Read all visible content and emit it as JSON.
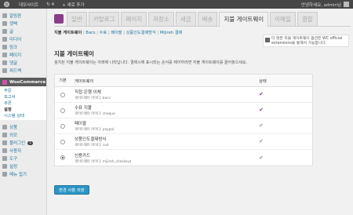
{
  "adminbar": {
    "site_name": "데모사이트",
    "updates_count": "4",
    "new_item": "+ 새로 추가",
    "greeting": "안녕하세요, admin님"
  },
  "sidebar": {
    "items": [
      {
        "label": "알림판",
        "icon": "dashboard-icon"
      },
      {
        "label": "젯팩",
        "icon": "jetpack-icon"
      },
      {
        "label": "글",
        "icon": "posts-icon"
      },
      {
        "label": "미디어",
        "icon": "media-icon"
      },
      {
        "label": "링크",
        "icon": "links-icon"
      },
      {
        "label": "페이지",
        "icon": "pages-icon"
      },
      {
        "label": "댓글",
        "icon": "comments-icon"
      },
      {
        "label": "피드백",
        "icon": "feedback-icon"
      }
    ],
    "woo": {
      "label": "WooCommerce",
      "icon": "woocommerce-icon"
    },
    "woo_sub": [
      "주문",
      "보고서",
      "쿠폰",
      "설정",
      "시스템 상태"
    ],
    "items2": [
      {
        "label": "상품",
        "icon": "products-icon"
      },
      {
        "label": "외모",
        "icon": "appearance-icon"
      },
      {
        "label": "플러그인",
        "icon": "plugins-icon",
        "badge": "1"
      },
      {
        "label": "사용자",
        "icon": "users-icon"
      },
      {
        "label": "도구",
        "icon": "tools-icon"
      },
      {
        "label": "설정",
        "icon": "settings-icon"
      },
      {
        "label": "메뉴 접기",
        "icon": "collapse-icon"
      }
    ]
  },
  "tabs": [
    "일반",
    "카탈로그",
    "페이지",
    "저장소",
    "세금",
    "배송",
    "지불 게이트웨이",
    "이메일",
    "결합"
  ],
  "subnav": {
    "current": "지불 게이트웨이",
    "links": [
      "Bacs",
      "수표",
      "페이팔",
      "상품인도결제방식",
      "Mijireh 결제"
    ]
  },
  "notice": {
    "text": "더 많은 지불 게이트웨이 옵션은 WC official extensions을 통해서 가능합니다."
  },
  "section": {
    "title": "지불 게이트웨이",
    "desc": "설치된 지불 게이트웨이는 아래에 나타납니다. 결제시에 표시되는 순서를 제어하려면 지불 게이트웨이를 끌어놓으세요."
  },
  "table": {
    "headers": {
      "default": "기본",
      "gateway": "게이트웨이",
      "status": "상태"
    },
    "rows": [
      {
        "title": "직접 은행 이체",
        "id": "게이트웨이 아이디: bacs",
        "enabled": true,
        "selected": false,
        "check_color": "#8a3e8a"
      },
      {
        "title": "수표 지불",
        "id": "게이트웨이 아이디: cheque",
        "enabled": true,
        "selected": false,
        "check_color": "#8a3e8a"
      },
      {
        "title": "페이팔",
        "id": "게이트웨이 아이디: paypal",
        "enabled": true,
        "selected": false,
        "check_color": "#999999"
      },
      {
        "title": "상품인도결제방식",
        "id": "게이트웨이 아이디: cod",
        "enabled": true,
        "selected": false,
        "check_color": "#999999"
      },
      {
        "title": "신용카드",
        "id": "게이트웨이 아이디: mijireh_checkout",
        "enabled": true,
        "selected": true,
        "check_color": "#999999"
      }
    ]
  },
  "save_label": "변경 사항 저장",
  "colors": {
    "accent": "#8a3e8a",
    "link": "#21759b",
    "button": "#2a95c5"
  }
}
